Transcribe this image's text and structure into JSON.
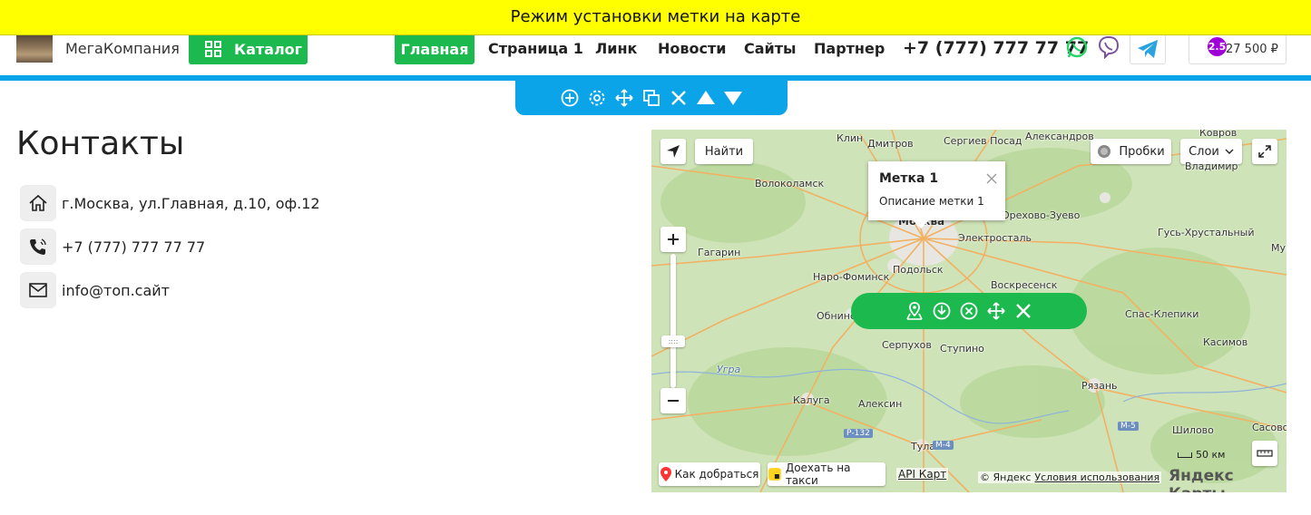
{
  "banner": {
    "text": "Режим установки метки на карте"
  },
  "header": {
    "company": "МегаКомпания",
    "catalog_label": "Каталог",
    "nav": [
      "Главная",
      "Страница 1",
      "Линк",
      "Новости",
      "Сайты",
      "Партнер"
    ],
    "phone": "+7 (777) 777 77 77",
    "cart_total": "27 500 ₽",
    "cart_badge": "2.5"
  },
  "edit_toolbar": {
    "icons": [
      "plus-circle-icon",
      "gear-icon",
      "move-icon",
      "copy-icon",
      "close-icon",
      "arrow-up-icon",
      "arrow-down-icon"
    ]
  },
  "page": {
    "title": "Контакты",
    "contacts": [
      {
        "icon": "home-icon",
        "text": "г.Москва, ул.Главная, д.10, оф.12"
      },
      {
        "icon": "phone-icon",
        "text": "+7 (777) 777 77 77"
      },
      {
        "icon": "mail-icon",
        "text": "info@топ.сайт"
      }
    ]
  },
  "map": {
    "find_label": "Найти",
    "traffic_label": "Пробки",
    "layers_label": "Слои",
    "balloon_title": "Метка 1",
    "balloon_desc": "Описание метки 1",
    "scale_label": "50 км",
    "route_label": "Как добраться",
    "taxi_label": "Доехать на такси",
    "api_label": "API Карт",
    "copyright": "© Яндекс",
    "terms": "Условия использования",
    "brand": "Яндекс Карты",
    "cities": [
      "Клин",
      "Дмитров",
      "Сергиев Посад",
      "Александров",
      "Ковров",
      "Волоколамск",
      "Владимир",
      "Москва",
      "Орехово-Зуево",
      "Гагарин",
      "Электросталь",
      "Гусь-Хрустальный",
      "Наро-Фоминск",
      "Подольск",
      "Воскресенск",
      "Муром",
      "Обнинск",
      "Спас-Клепики",
      "Серпухов",
      "Ступино",
      "Касимов",
      "Калуга",
      "Алексин",
      "Рязань",
      "Тула",
      "Шилово",
      "Сасово",
      "Угра",
      "Р-132",
      "М-4",
      "М-5"
    ],
    "toolbar_icons": [
      "map-pin-icon",
      "download-icon",
      "close-circle-icon",
      "move-icon",
      "close-icon"
    ]
  }
}
